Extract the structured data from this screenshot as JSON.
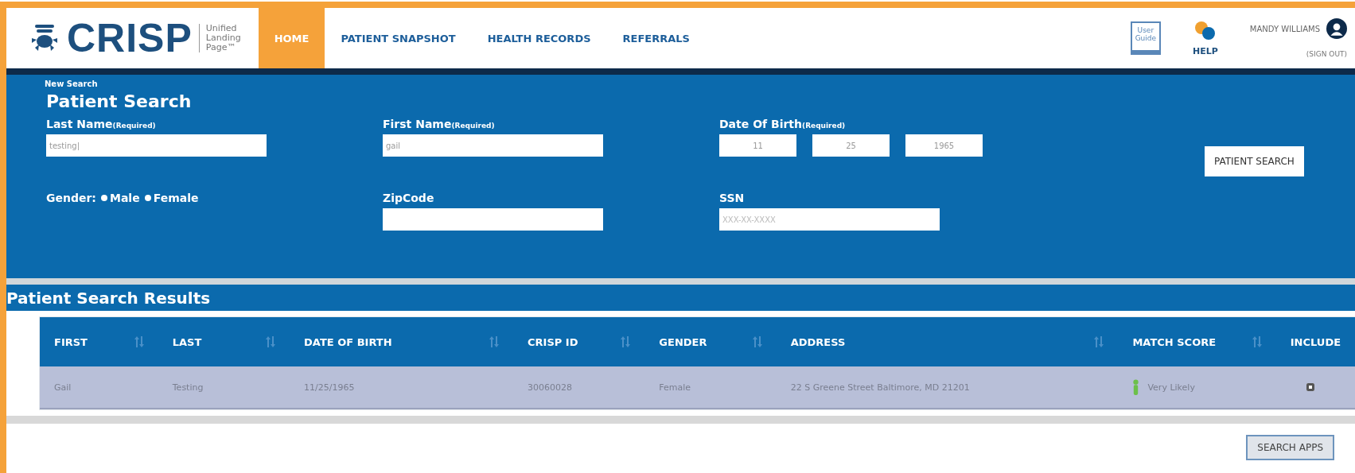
{
  "header": {
    "logo": "CRISP",
    "tagline": [
      "Unified",
      "Landing",
      "Page™"
    ],
    "nav": [
      {
        "label": "HOME",
        "selected": true
      },
      {
        "label": "PATIENT SNAPSHOT",
        "selected": false
      },
      {
        "label": "HEALTH RECORDS",
        "selected": false
      },
      {
        "label": "REFERRALS",
        "selected": false
      }
    ],
    "user_guide": [
      "User",
      "Guide"
    ],
    "help": "HELP",
    "user": "MANDY WILLIAMS",
    "sign_out": "(SIGN OUT)"
  },
  "search": {
    "breadcrumb": "New Search",
    "title": "Patient Search",
    "last_name": {
      "label": "Last Name",
      "note": "(Required)",
      "value": "testing|"
    },
    "first_name": {
      "label": "First Name",
      "note": "(Required)",
      "value": "gail"
    },
    "dob": {
      "label": "Date Of Birth",
      "note": "(Required)",
      "values": [
        "11",
        "25",
        "1965"
      ]
    },
    "button": "PATIENT SEARCH",
    "gender": {
      "label": "Gender:",
      "options": [
        {
          "label": "Male",
          "selected": false
        },
        {
          "label": "Female",
          "selected": false
        }
      ]
    },
    "zip": {
      "label": "ZipCode"
    },
    "ssn": {
      "label": "SSN",
      "placeholder": "XXX-XX-XXXX"
    }
  },
  "results": {
    "title": "Patient Search Results",
    "columns": [
      "FIRST",
      "LAST",
      "DATE OF BIRTH",
      "CRISP ID",
      "GENDER",
      "ADDRESS",
      "MATCH SCORE",
      "INCLUDE"
    ],
    "rows": [
      {
        "cells": [
          "Gail",
          "Testing",
          "11/25/1965",
          "30060028",
          "Female",
          "22 S Greene Street Baltimore, MD 21201"
        ],
        "match": "Very Likely",
        "include": true
      }
    ]
  },
  "footer_button": "SEARCH APPS"
}
